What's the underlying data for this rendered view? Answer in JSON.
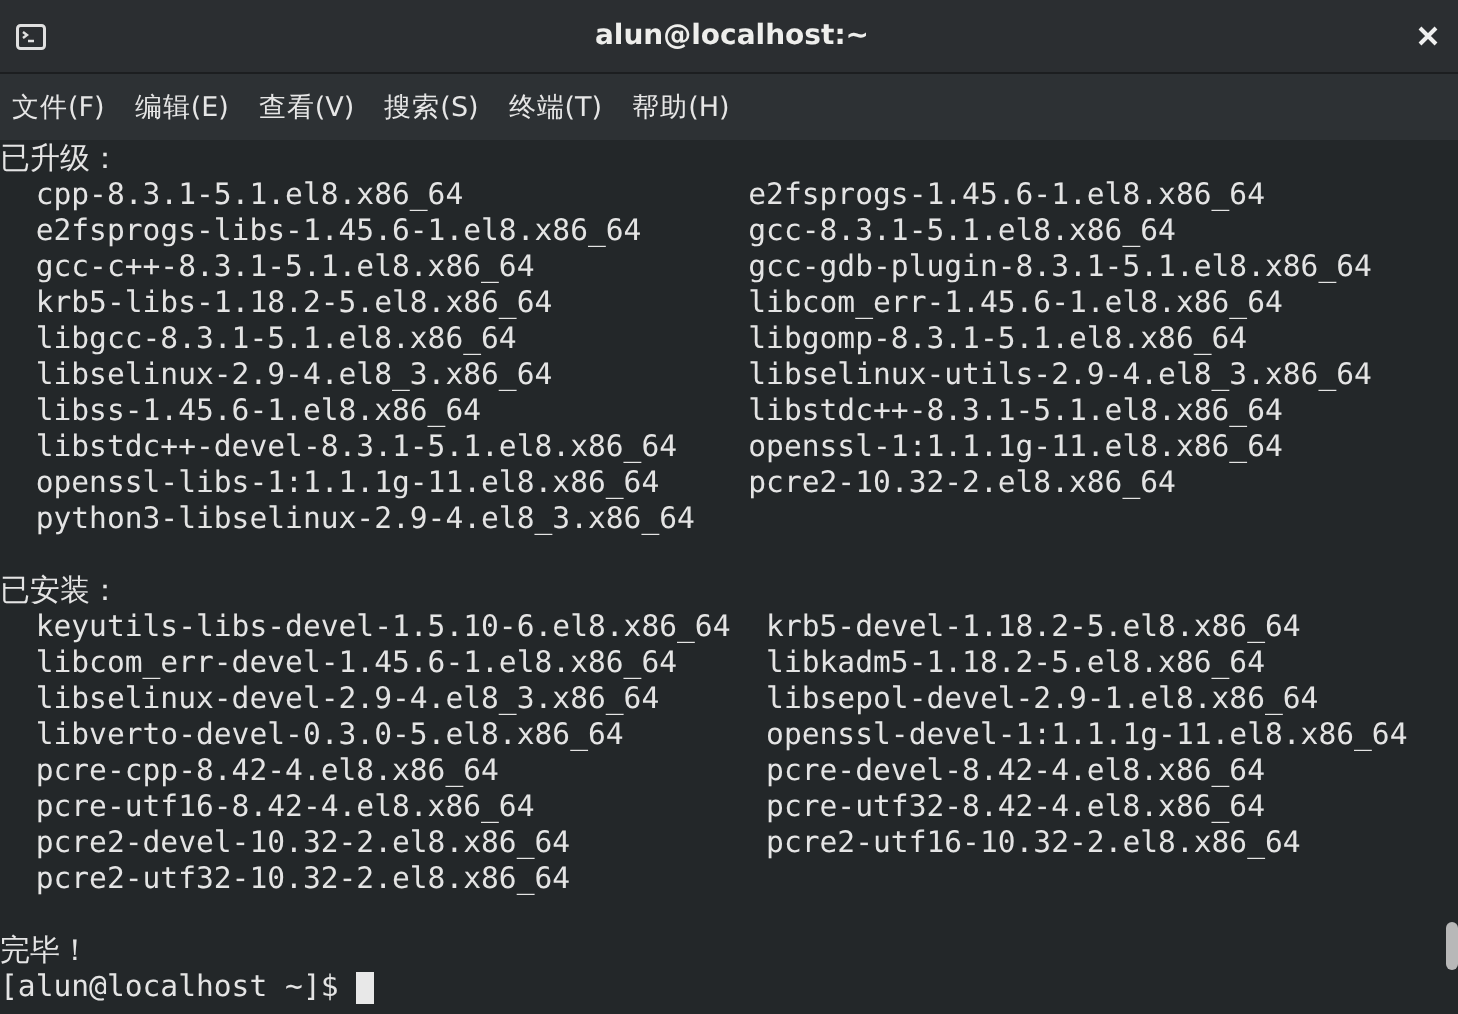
{
  "window": {
    "title": "alun@localhost:~"
  },
  "menu": [
    {
      "label": "文件(F)"
    },
    {
      "label": "编辑(E)"
    },
    {
      "label": "查看(V)"
    },
    {
      "label": "搜索(S)"
    },
    {
      "label": "终端(T)"
    },
    {
      "label": "帮助(H)"
    }
  ],
  "terminal": {
    "sections": [
      {
        "heading": "已升级：",
        "rows": [
          [
            "cpp-8.3.1-5.1.el8.x86_64",
            "e2fsprogs-1.45.6-1.el8.x86_64"
          ],
          [
            "e2fsprogs-libs-1.45.6-1.el8.x86_64",
            "gcc-8.3.1-5.1.el8.x86_64"
          ],
          [
            "gcc-c++-8.3.1-5.1.el8.x86_64",
            "gcc-gdb-plugin-8.3.1-5.1.el8.x86_64"
          ],
          [
            "krb5-libs-1.18.2-5.el8.x86_64",
            "libcom_err-1.45.6-1.el8.x86_64"
          ],
          [
            "libgcc-8.3.1-5.1.el8.x86_64",
            "libgomp-8.3.1-5.1.el8.x86_64"
          ],
          [
            "libselinux-2.9-4.el8_3.x86_64",
            "libselinux-utils-2.9-4.el8_3.x86_64"
          ],
          [
            "libss-1.45.6-1.el8.x86_64",
            "libstdc++-8.3.1-5.1.el8.x86_64"
          ],
          [
            "libstdc++-devel-8.3.1-5.1.el8.x86_64",
            "openssl-1:1.1.1g-11.el8.x86_64"
          ],
          [
            "openssl-libs-1:1.1.1g-11.el8.x86_64",
            "pcre2-10.32-2.el8.x86_64"
          ],
          [
            "python3-libselinux-2.9-4.el8_3.x86_64"
          ]
        ]
      },
      {
        "heading": "已安装：",
        "rows": [
          [
            "keyutils-libs-devel-1.5.10-6.el8.x86_64",
            "krb5-devel-1.18.2-5.el8.x86_64"
          ],
          [
            "libcom_err-devel-1.45.6-1.el8.x86_64",
            "libkadm5-1.18.2-5.el8.x86_64"
          ],
          [
            "libselinux-devel-2.9-4.el8_3.x86_64",
            "libsepol-devel-2.9-1.el8.x86_64"
          ],
          [
            "libverto-devel-0.3.0-5.el8.x86_64",
            "openssl-devel-1:1.1.1g-11.el8.x86_64"
          ],
          [
            "pcre-cpp-8.42-4.el8.x86_64",
            "pcre-devel-8.42-4.el8.x86_64"
          ],
          [
            "pcre-utf16-8.42-4.el8.x86_64",
            "pcre-utf32-8.42-4.el8.x86_64"
          ],
          [
            "pcre2-devel-10.32-2.el8.x86_64",
            "pcre2-utf16-10.32-2.el8.x86_64"
          ],
          [
            "pcre2-utf32-10.32-2.el8.x86_64"
          ]
        ]
      }
    ],
    "completion": "完毕！",
    "prompt": "[alun@localhost ~]$"
  }
}
